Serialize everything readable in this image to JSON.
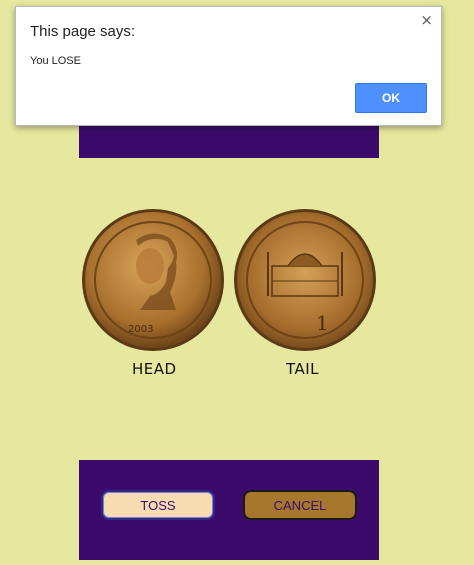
{
  "dialog": {
    "title": "This page says:",
    "message": "You LOSE",
    "close_glyph": "×",
    "ok_label": "OK"
  },
  "coins": {
    "head_label": "HEAD",
    "tail_label": "TAIL"
  },
  "controls": {
    "toss_label": "TOSS",
    "cancel_label": "CANCEL"
  },
  "colors": {
    "page_background": "#e6e89f",
    "band": "#3b0a6b",
    "toss_button": "#f6dcb0",
    "cancel_button": "#a6772c",
    "ok_button": "#4d90fe"
  }
}
